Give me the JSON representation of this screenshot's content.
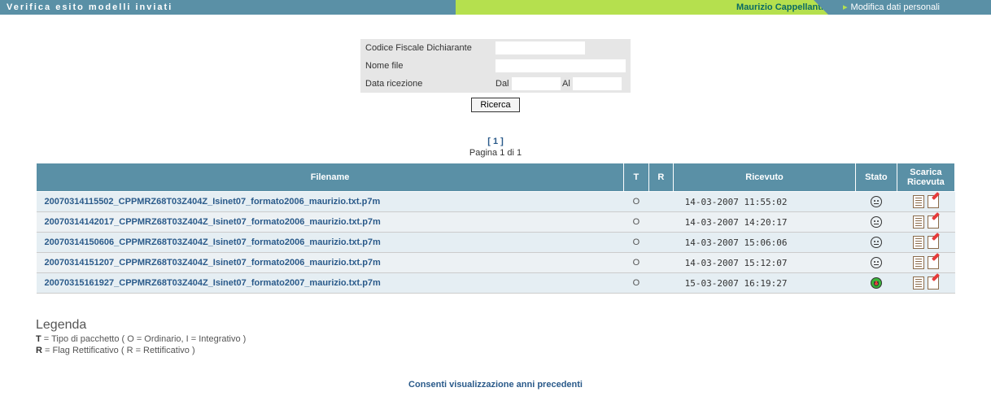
{
  "header": {
    "title": "Verifica esito modelli inviati",
    "user": "Maurizio Cappellanti",
    "personal_link": "Modifica dati personali"
  },
  "search": {
    "codice_fiscale_label": "Codice Fiscale Dichiarante",
    "codice_fiscale_value": "",
    "nome_file_label": "Nome file",
    "nome_file_value": "",
    "data_ricezione_label": "Data ricezione",
    "dal_label": "Dal",
    "dal_value": "",
    "al_label": "Al",
    "al_value": "",
    "button": "Ricerca"
  },
  "pager": {
    "pages": "[ 1 ]",
    "summary": "Pagina 1 di 1"
  },
  "table": {
    "headers": {
      "filename": "Filename",
      "t": "T",
      "r": "R",
      "ricevuto": "Ricevuto",
      "stato": "Stato",
      "scarica": "Scarica Ricevuta"
    },
    "rows": [
      {
        "filename": "20070314115502_CPPMRZ68T03Z404Z_Isinet07_formato2006_maurizio.txt.p7m",
        "t": "O",
        "r": "",
        "ricevuto": "14-03-2007 11:55:02",
        "stato": "neutral"
      },
      {
        "filename": "20070314142017_CPPMRZ68T03Z404Z_Isinet07_formato2006_maurizio.txt.p7m",
        "t": "O",
        "r": "",
        "ricevuto": "14-03-2007 14:20:17",
        "stato": "neutral"
      },
      {
        "filename": "20070314150606_CPPMRZ68T03Z404Z_Isinet07_formato2006_maurizio.txt.p7m",
        "t": "O",
        "r": "",
        "ricevuto": "14-03-2007 15:06:06",
        "stato": "neutral"
      },
      {
        "filename": "20070314151207_CPPMRZ68T03Z404Z_Isinet07_formato2006_maurizio.txt.p7m",
        "t": "O",
        "r": "",
        "ricevuto": "14-03-2007 15:12:07",
        "stato": "neutral"
      },
      {
        "filename": "20070315161927_CPPMRZ68T03Z404Z_Isinet07_formato2007_maurizio.txt.p7m",
        "t": "O",
        "r": "",
        "ricevuto": "15-03-2007 16:19:27",
        "stato": "happy"
      }
    ]
  },
  "legend": {
    "title": "Legenda",
    "line1_bold": "T",
    "line1_rest": " = Tipo di pacchetto ( O = Ordinario, I = Integrativo )",
    "line2_bold": "R",
    "line2_rest": " = Flag Rettificativo ( R = Rettificativo )"
  },
  "footer_link": "Consenti visualizzazione anni precedenti"
}
